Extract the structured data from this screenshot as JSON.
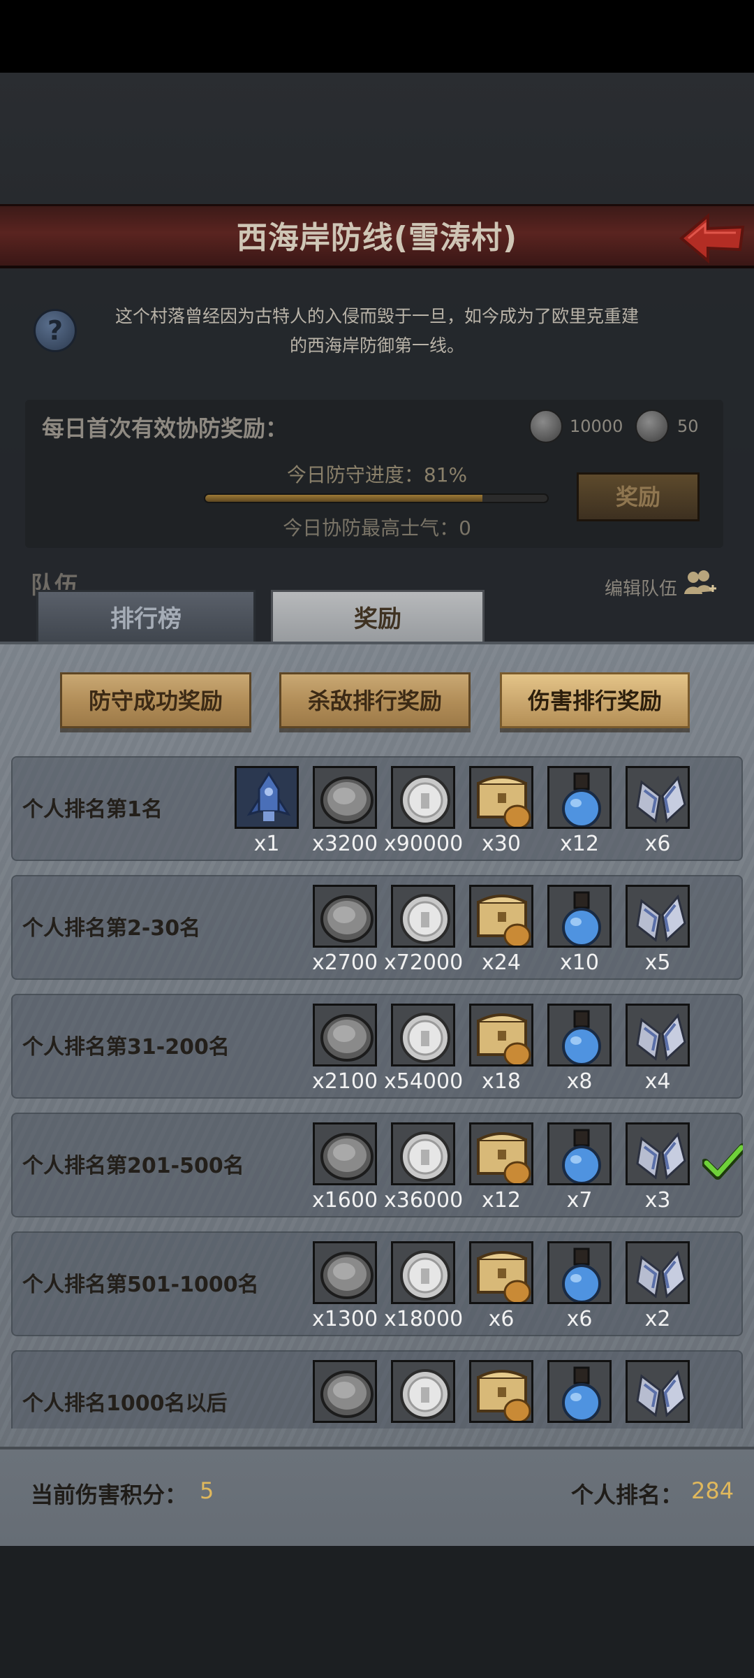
{
  "header": {
    "title": "西海岸防线(雪涛村)"
  },
  "info": {
    "description_line1": "这个村落曾经因为古特人的入侵而毁于一旦，如今成为了欧里克重建",
    "description_line2": "的西海岸防御第一线。",
    "daily_reward_label": "每日首次有效协防奖励：",
    "daily_reward_coin1": "10000",
    "daily_reward_coin2": "50",
    "progress_label": "今日防守进度：81%",
    "progress_value": 81,
    "morale_label": "今日协防最高士气：0",
    "reward_button": "奖励",
    "team_label": "队伍",
    "edit_team": "编辑队伍"
  },
  "tabs": [
    {
      "label": "排行榜",
      "active": false
    },
    {
      "label": "奖励",
      "active": true
    }
  ],
  "categories": [
    {
      "label": "防守成功奖励"
    },
    {
      "label": "杀敌排行奖励"
    },
    {
      "label": "伤害排行奖励",
      "active": true
    }
  ],
  "rewards": [
    {
      "label": "个人排名第1名",
      "qty": [
        "x1",
        "x3200",
        "x90000",
        "x30",
        "x12",
        "x6"
      ]
    },
    {
      "label": "个人排名第2-30名",
      "qty": [
        "x2700",
        "x72000",
        "x24",
        "x10",
        "x5"
      ]
    },
    {
      "label": "个人排名第31-200名",
      "qty": [
        "x2100",
        "x54000",
        "x18",
        "x8",
        "x4"
      ]
    },
    {
      "label": "个人排名第201-500名",
      "qty": [
        "x1600",
        "x36000",
        "x12",
        "x7",
        "x3"
      ],
      "current": true
    },
    {
      "label": "个人排名第501-1000名",
      "qty": [
        "x1300",
        "x18000",
        "x6",
        "x6",
        "x2"
      ]
    },
    {
      "label": "个人排名1000名以后",
      "qty": [
        "",
        "",
        "",
        "",
        ""
      ]
    }
  ],
  "item_icons": [
    "rocket-icon",
    "iron-coin-icon",
    "silver-coin-icon",
    "treasure-chest-icon",
    "blue-potion-icon",
    "crystal-wings-icon"
  ],
  "footer": {
    "score_label": "当前伤害积分：",
    "score_value": "5",
    "rank_label": "个人排名：",
    "rank_value": "284"
  }
}
